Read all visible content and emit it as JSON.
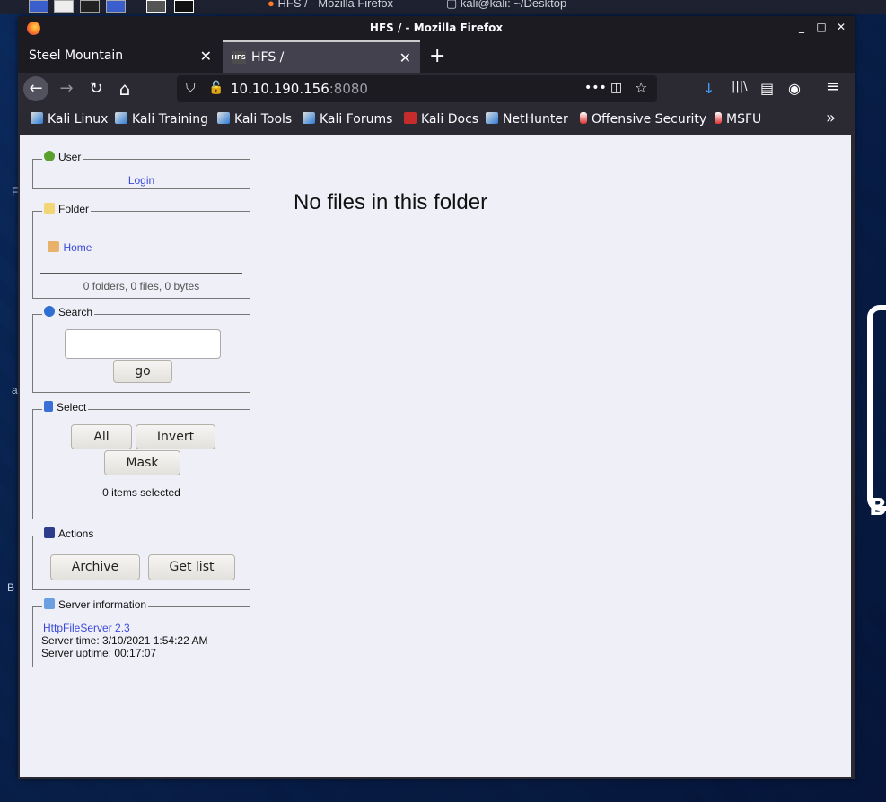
{
  "desktop": {
    "panel_items": [
      "HFS / - Mozilla Firefox",
      "kali@kali: ~/Desktop"
    ],
    "right_letter": "B",
    "left_letters": [
      "F",
      "a",
      "B"
    ]
  },
  "window": {
    "title": "HFS / - Mozilla Firefox",
    "controls": {
      "minimize": "_",
      "maximize": "□",
      "close": "✕"
    }
  },
  "tabs": [
    {
      "label": "Steel Mountain",
      "active": false,
      "close": "✕"
    },
    {
      "label": "HFS /",
      "active": true,
      "close": "✕",
      "icon_text": "HFS"
    }
  ],
  "newtab_label": "+",
  "nav": {
    "back": "←",
    "forward": "→",
    "reload": "↻",
    "home": "⌂",
    "url_host": "10.10.190.156",
    "url_port": ":8080",
    "page_actions": "•••",
    "pocket": "◫",
    "star": "☆",
    "download": "↓",
    "library": "|||\\",
    "sidebar": "▤",
    "account": "◉",
    "menu": "≡"
  },
  "bookmarks": [
    {
      "label": "Kali Linux",
      "icon": "kali"
    },
    {
      "label": "Kali Training",
      "icon": "kali"
    },
    {
      "label": "Kali Tools",
      "icon": "kali"
    },
    {
      "label": "Kali Forums",
      "icon": "kali"
    },
    {
      "label": "Kali Docs",
      "icon": "red"
    },
    {
      "label": "NetHunter",
      "icon": "kali"
    },
    {
      "label": "Offensive Security",
      "icon": "flask"
    },
    {
      "label": "MSFU",
      "icon": "flask"
    }
  ],
  "bookmarks_overflow": "»",
  "panels": {
    "user": {
      "title": "User",
      "login": "Login"
    },
    "folder": {
      "title": "Folder",
      "home": "Home",
      "summary": "0 folders, 0 files, 0 bytes"
    },
    "search": {
      "title": "Search",
      "go": "go",
      "value": ""
    },
    "select": {
      "title": "Select",
      "all": "All",
      "invert": "Invert",
      "mask": "Mask",
      "status": "0 items selected"
    },
    "actions": {
      "title": "Actions",
      "archive": "Archive",
      "get_list": "Get list"
    },
    "server": {
      "title": "Server information",
      "version_link": "HttpFileServer 2.3",
      "time": "Server time: 3/10/2021 1:54:22 AM",
      "uptime": "Server uptime: 00:17:07"
    }
  },
  "main_message": "No files in this folder",
  "colors": {
    "link": "#3a49d8",
    "page_bg": "#efeff8",
    "chrome_dark": "#1c1b22",
    "chrome": "#2b2a33"
  }
}
